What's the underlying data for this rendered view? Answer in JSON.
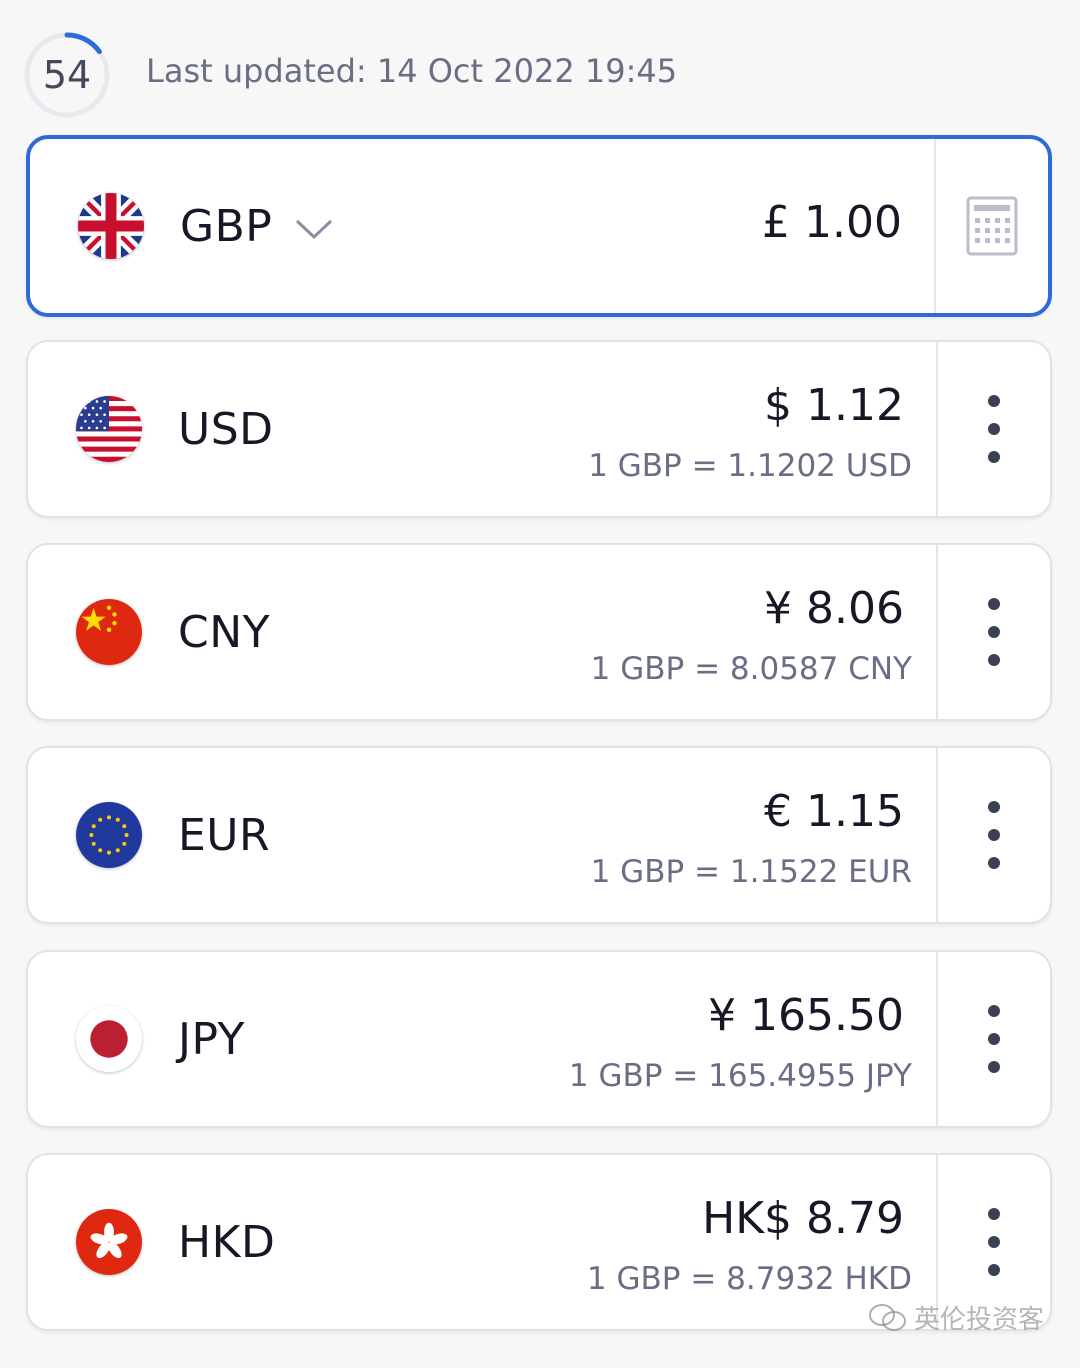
{
  "header": {
    "timer_value": "54",
    "timer_progress": 0.15,
    "last_updated": "Last updated: 14 Oct 2022 19:45"
  },
  "base": {
    "code": "GBP",
    "amount": "£ 1.00",
    "flag": "uk-flag-icon",
    "calculator_icon": "calculator-icon"
  },
  "rows": [
    {
      "code": "USD",
      "amount": "$ 1.12",
      "rate": "1 GBP = 1.1202 USD",
      "flag": "us-flag-icon"
    },
    {
      "code": "CNY",
      "amount": "¥ 8.06",
      "rate": "1 GBP = 8.0587 CNY",
      "flag": "china-flag-icon"
    },
    {
      "code": "EUR",
      "amount": "€ 1.15",
      "rate": "1 GBP = 1.1522 EUR",
      "flag": "eu-flag-icon"
    },
    {
      "code": "JPY",
      "amount": "¥ 165.50",
      "rate": "1 GBP = 165.4955 JPY",
      "flag": "japan-flag-icon"
    },
    {
      "code": "HKD",
      "amount": "HK$ 8.79",
      "rate": "1 GBP = 8.7932 HKD",
      "flag": "hong-kong-flag-icon"
    }
  ],
  "watermark": "英伦投资客",
  "colors": {
    "accent": "#2f6bd8",
    "muted_text": "#6a6e85",
    "card_border": "#e1e2e7"
  }
}
